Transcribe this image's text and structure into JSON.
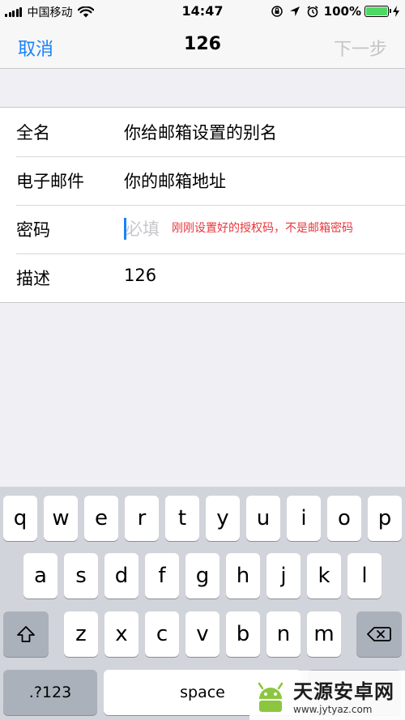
{
  "status_bar": {
    "carrier": "中国移动",
    "time": "14:47",
    "battery_percent": "100%",
    "battery_level": 1.0,
    "icons": [
      "signal-bars-icon",
      "wifi-icon",
      "orientation-lock-icon",
      "location-arrow-icon",
      "alarm-clock-icon",
      "battery-icon",
      "charging-bolt-icon"
    ]
  },
  "nav": {
    "cancel_label": "取消",
    "title": "126",
    "next_label": "下一步"
  },
  "form": {
    "rows": [
      {
        "label": "全名",
        "value": "你给邮箱设置的别名"
      },
      {
        "label": "电子邮件",
        "value": "你的邮箱地址"
      },
      {
        "label": "密码",
        "placeholder": "必填",
        "note": "刚刚设置好的授权码，不是邮箱密码"
      },
      {
        "label": "描述",
        "value": "126"
      }
    ]
  },
  "keyboard": {
    "row1": [
      "q",
      "w",
      "e",
      "r",
      "t",
      "y",
      "u",
      "i",
      "o",
      "p"
    ],
    "row2": [
      "a",
      "s",
      "d",
      "f",
      "g",
      "h",
      "j",
      "k",
      "l"
    ],
    "row3": [
      "z",
      "x",
      "c",
      "v",
      "b",
      "n",
      "m"
    ],
    "numbers_label": ".?123",
    "space_label": "space"
  },
  "watermark": {
    "title": "天源安卓网",
    "url": "www.jytyaz.com"
  },
  "colors": {
    "accent": "#1a82fb",
    "disabled": "#c4c4c8",
    "note": "#e8363a",
    "battery": "#4cd964"
  }
}
